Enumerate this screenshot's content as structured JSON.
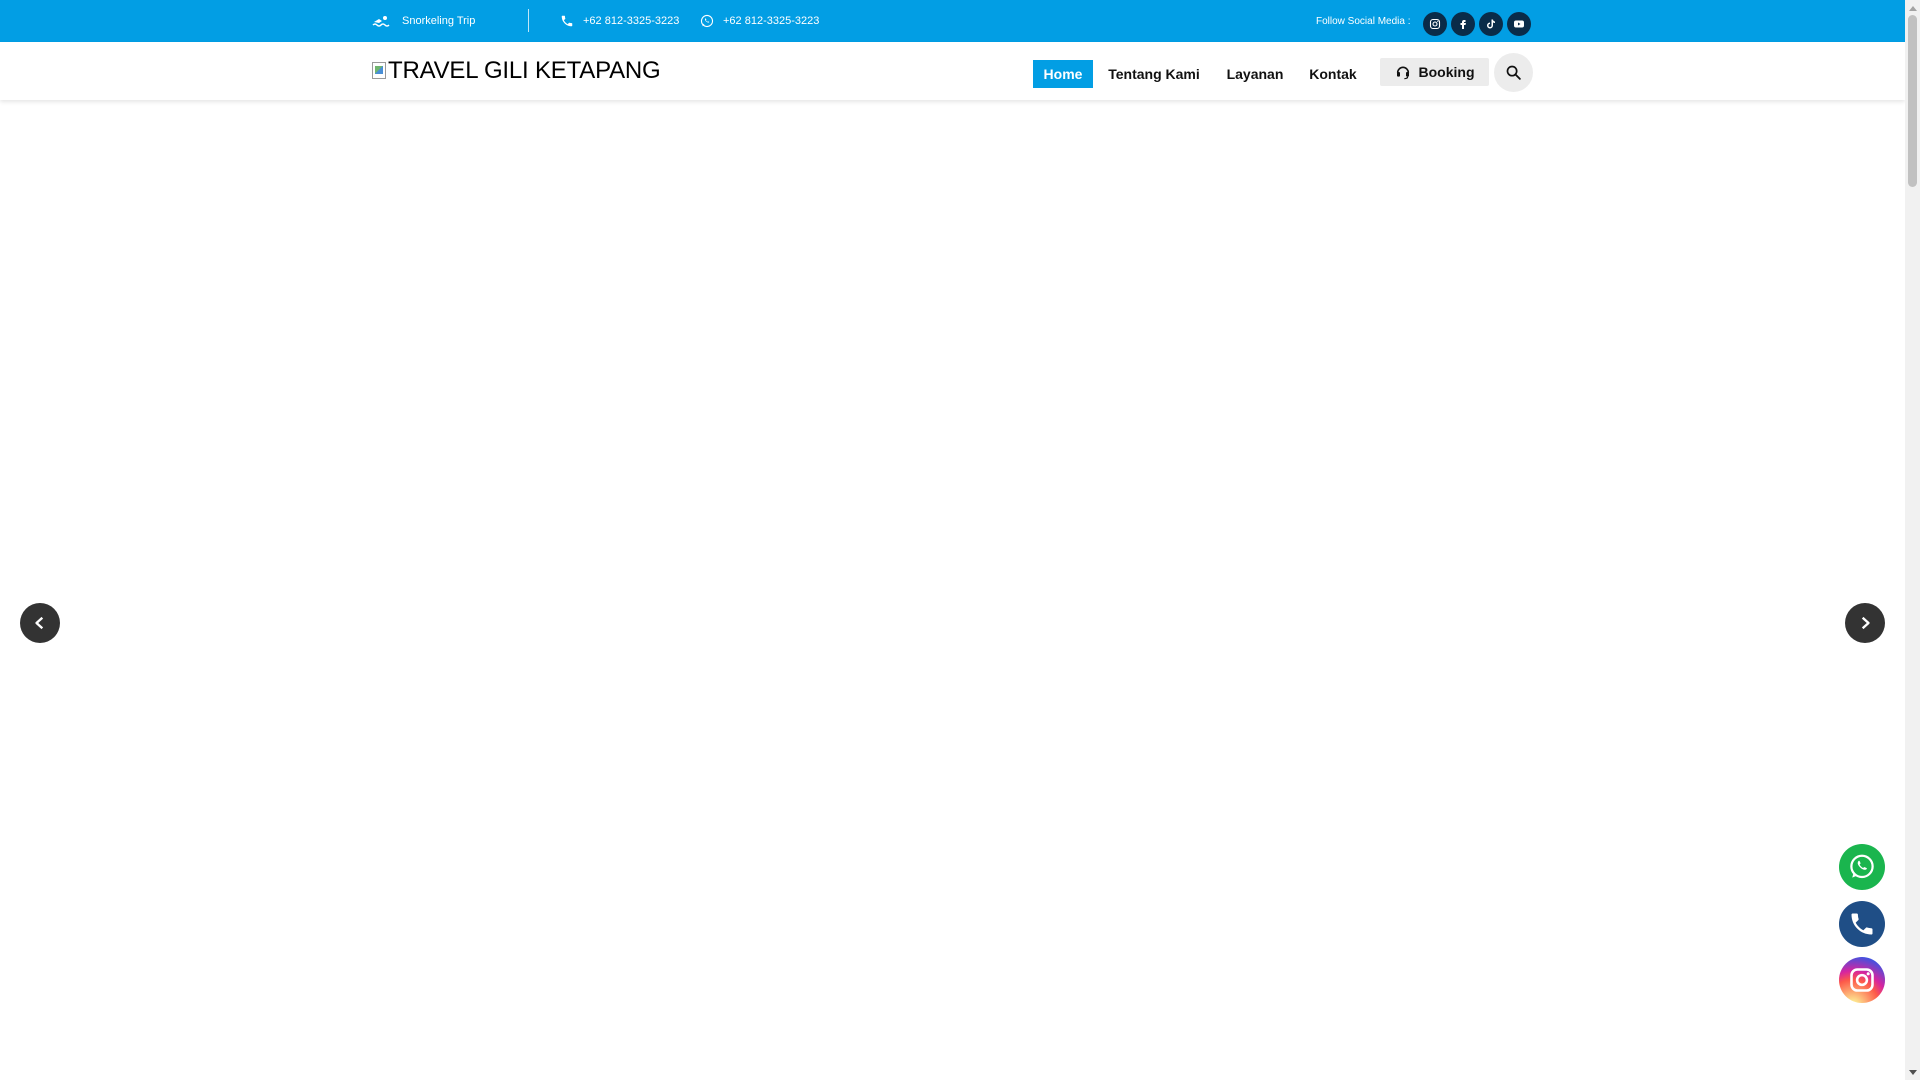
{
  "topbar": {
    "snorkeling_label": "Snorkeling Trip",
    "phone_label": "+62 812-3325-3223",
    "whatsapp_label": "+62 812-3325-3223",
    "follow_label": "Follow Social Media :",
    "social": [
      {
        "icon": "instagram-icon"
      },
      {
        "icon": "facebook-icon"
      },
      {
        "icon": "tiktok-icon"
      },
      {
        "icon": "youtube-icon"
      }
    ],
    "background": "#029ee4"
  },
  "navbar": {
    "logo_text": "TRAVEL GILI KETAPANG",
    "links": [
      {
        "label": "Home",
        "active": true
      },
      {
        "label": "Tentang Kami",
        "active": false
      },
      {
        "label": "Layanan",
        "active": false
      },
      {
        "label": "Kontak",
        "active": false
      }
    ],
    "booking_label": "Booking",
    "search_icon": "search-icon",
    "accent": "#029ee4"
  },
  "slider": {
    "prev_icon": "chevron-left-icon",
    "next_icon": "chevron-right-icon"
  },
  "floating": [
    {
      "icon": "whatsapp-icon",
      "color": "#1ab54e"
    },
    {
      "icon": "phone-icon",
      "color": "#1f4e86"
    },
    {
      "icon": "instagram-icon",
      "color": "#d6249f"
    }
  ]
}
